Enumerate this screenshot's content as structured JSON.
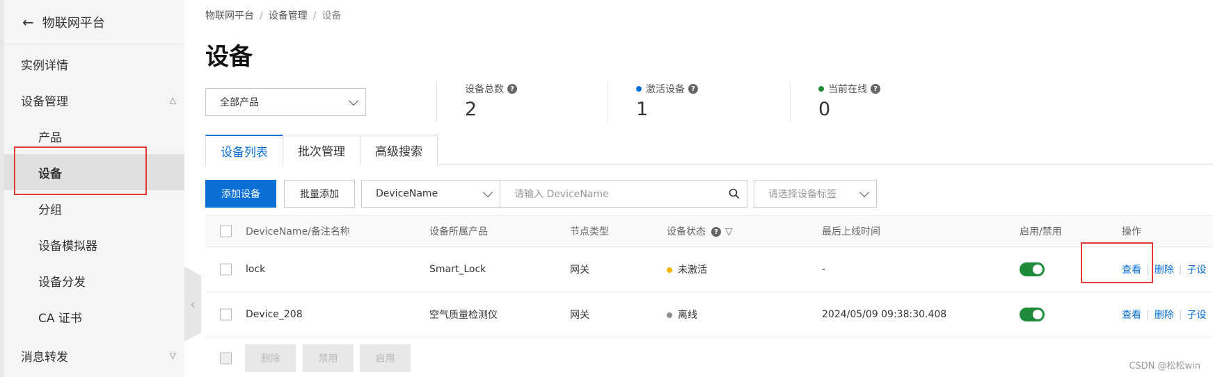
{
  "sidebar": {
    "back_label": "物联网平台",
    "items": [
      {
        "label": "实例详情"
      },
      {
        "label": "设备管理"
      },
      {
        "label": "产品"
      },
      {
        "label": "设备"
      },
      {
        "label": "分组"
      },
      {
        "label": "设备模拟器"
      },
      {
        "label": "设备分发"
      },
      {
        "label": "CA 证书"
      },
      {
        "label": "消息转发"
      }
    ]
  },
  "breadcrumb": [
    "物联网平台",
    "设备管理",
    "设备"
  ],
  "page_title": "设备",
  "product_select": {
    "value": "全部产品"
  },
  "stats": [
    {
      "label": "设备总数",
      "value": "2",
      "dot_color": ""
    },
    {
      "label": "激活设备",
      "value": "1",
      "dot_color": "#0a6fd6"
    },
    {
      "label": "当前在线",
      "value": "0",
      "dot_color": "#1f8a3a"
    }
  ],
  "tabs": [
    "设备列表",
    "批次管理",
    "高级搜索"
  ],
  "toolbar": {
    "add_device": "添加设备",
    "batch_add": "批量添加",
    "field_select": "DeviceName",
    "search_placeholder": "请输入 DeviceName",
    "tag_select": "请选择设备标签"
  },
  "table": {
    "headers": [
      "DeviceName/备注名称",
      "设备所属产品",
      "节点类型",
      "设备状态",
      "最后上线时间",
      "启用/禁用",
      "操作"
    ],
    "rows": [
      {
        "name": "lock",
        "product": "Smart_Lock",
        "node": "网关",
        "status": "未激活",
        "status_color": "#f5b800",
        "last_online": "-",
        "actions": [
          "查看",
          "删除",
          "子设"
        ]
      },
      {
        "name": "Device_208",
        "product": "空气质量检测仪",
        "node": "网关",
        "status": "离线",
        "status_color": "#8c8c8c",
        "last_online": "2024/05/09 09:38:30.408",
        "actions": [
          "查看",
          "删除",
          "子设"
        ]
      }
    ]
  },
  "bulk_actions": [
    "删除",
    "禁用",
    "启用"
  ],
  "watermark": "CSDN @松松win",
  "colors": {
    "accent": "#0a6fd6",
    "highlight": "#e53935",
    "switch_on": "#1f8a3a"
  }
}
